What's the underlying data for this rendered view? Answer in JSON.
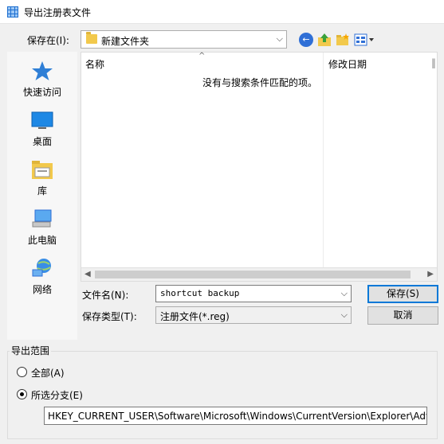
{
  "window": {
    "title": "导出注册表文件"
  },
  "toolbar": {
    "save_in_label": "保存在(I):",
    "save_in_value": "新建文件夹",
    "icons": [
      "back-icon",
      "up-folder-icon",
      "new-folder-icon",
      "view-menu-icon"
    ]
  },
  "places": [
    {
      "label": "快速访问",
      "icon": "star-icon"
    },
    {
      "label": "桌面",
      "icon": "desktop-icon"
    },
    {
      "label": "库",
      "icon": "library-icon"
    },
    {
      "label": "此电脑",
      "icon": "computer-icon"
    },
    {
      "label": "网络",
      "icon": "network-icon"
    }
  ],
  "filelist": {
    "columns": [
      "名称",
      "修改日期",
      "‖"
    ],
    "empty_message": "没有与搜索条件匹配的项。"
  },
  "form": {
    "filename_label": "文件名(N):",
    "filename_value": "shortcut backup",
    "filetype_label": "保存类型(T):",
    "filetype_value": "注册文件(*.reg)",
    "save_button": "保存(S)",
    "cancel_button": "取消"
  },
  "export_range": {
    "title": "导出范围",
    "all_label": "全部(A)",
    "selected_label": "所选分支(E)",
    "selected_checked": true,
    "branch_path": "HKEY_CURRENT_USER\\Software\\Microsoft\\Windows\\CurrentVersion\\Explorer\\Advanced"
  }
}
